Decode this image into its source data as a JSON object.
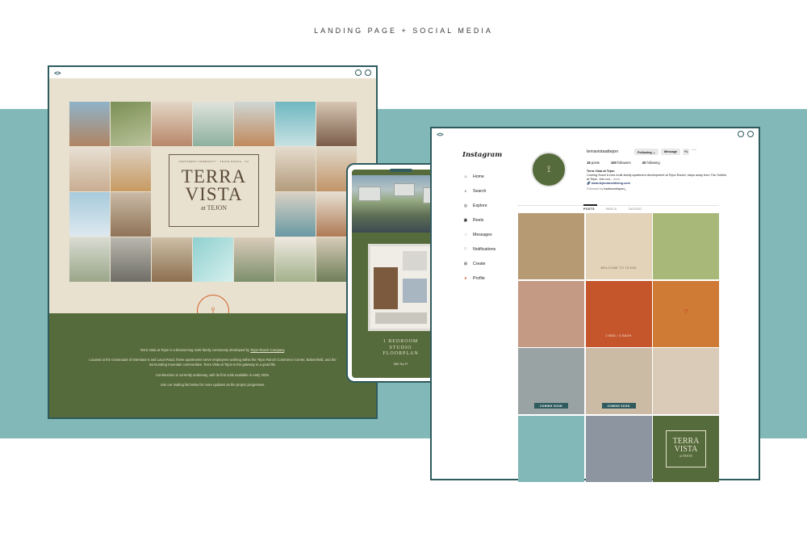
{
  "page": {
    "heading": "LANDING PAGE + SOCIAL MEDIA"
  },
  "colors": {
    "teal": "#82b9b8",
    "olive": "#566b3b",
    "cream": "#e9e1d0",
    "terracotta": "#d4622b",
    "frame": "#2f5b5e"
  },
  "browser_chrome": {
    "code_glyph": "<>",
    "dot_icons": [
      "circle-icon",
      "circle-icon"
    ]
  },
  "landing": {
    "logo_tag": "APARTMENT COMMUNITY · TEJON RANCH · CA",
    "logo_line1": "TERRA",
    "logo_line2": "VISTA",
    "logo_at": "at TEJON",
    "seal_text": "TERRA VISTA",
    "para1_prefix": "Terra Vista at Tejon is a blossoming multi-family community developed by ",
    "para1_link": "Tejon Ranch Company",
    "para1_suffix": ".",
    "para2": "Located at the crossroads of Interstate 5 and Laval Road, these apartments serve employees working within the Tejon Ranch Commerce Center, Bakersfield, and the surrounding mountain communities. Terra Vista at Tejon is the gateway to a good life.",
    "para3": "Construction is currently underway, with its first units available in early 2025.",
    "para4": "Join our mailing list below for more updates as the project progresses."
  },
  "phone": {
    "title_line1": "1 BEDROOM",
    "title_line2": "STUDIO",
    "title_line3": "FLOORPLAN",
    "sqft": "585 Sq Ft"
  },
  "instagram": {
    "logo": "Instagram",
    "nav": [
      {
        "label": "Home",
        "icon": "home-icon",
        "glyph": "⌂"
      },
      {
        "label": "Search",
        "icon": "search-icon",
        "glyph": "⌕"
      },
      {
        "label": "Explore",
        "icon": "compass-icon",
        "glyph": "◎"
      },
      {
        "label": "Reels",
        "icon": "reels-icon",
        "glyph": "▣"
      },
      {
        "label": "Messages",
        "icon": "messages-icon",
        "glyph": "◌"
      },
      {
        "label": "Notifications",
        "icon": "heart-icon",
        "glyph": "♡"
      },
      {
        "label": "Create",
        "icon": "plus-icon",
        "glyph": "⊞"
      },
      {
        "label": "Profile",
        "icon": "avatar-icon",
        "glyph": "●"
      }
    ],
    "profile": {
      "username": "terravistaattejon",
      "following_btn": "Following ⌄",
      "message_btn": "Message",
      "add_btn": "+⁠1",
      "more": "···",
      "posts": "16",
      "posts_label": "posts",
      "followers": "100",
      "followers_label": "followers",
      "following": "20",
      "following_label": "following",
      "bio_name": "Terra Vista at Tejon",
      "bio_text": "Coming Soon! A new multi-family apartment development at Tejon Ranch, steps away from The Outlets at Tejon. Join our... ",
      "bio_more": "more",
      "bio_link": "www.tejonranchliving.com",
      "followed_by": "Followed by ",
      "followed_user": "towilsonntiques_"
    },
    "tabs": [
      "POSTS",
      "REELS",
      "TAGGED"
    ],
    "tiles": [
      {
        "name": "construction-photo",
        "bg": "#b59a74",
        "caption": ""
      },
      {
        "name": "dog-box-photo",
        "bg": "#e3d3b8",
        "caption": "WELCOME TO TEJON"
      },
      {
        "name": "map-tile",
        "bg": "#a8b879",
        "caption": ""
      },
      {
        "name": "child-camera-photo",
        "bg": "#c49a84",
        "caption": ""
      },
      {
        "name": "floorplan-orange-tile",
        "bg": "#c5562b",
        "caption": "2 BED / 2 BATH"
      },
      {
        "name": "floorplan-mystery-tile",
        "bg": "#cf7a35",
        "caption": "?"
      },
      {
        "name": "site-aerial-photo",
        "bg": "#9aa3a3",
        "caption": "COMING SOON"
      },
      {
        "name": "tree-graphic-tile",
        "bg": "#cbbba5",
        "caption": "COMING SOON"
      },
      {
        "name": "interior-photo",
        "bg": "#d9cbb7",
        "caption": ""
      },
      {
        "name": "woman-laptop-tile",
        "bg": "#82b9b8",
        "caption": ""
      },
      {
        "name": "aerial-photo",
        "bg": "#8c95a0",
        "caption": ""
      },
      {
        "name": "logo-tile",
        "bg": "#566b3b",
        "caption": ""
      }
    ],
    "logo_tile": {
      "line1": "TERRA",
      "line2": "VISTA",
      "at": "at TEJON"
    }
  }
}
